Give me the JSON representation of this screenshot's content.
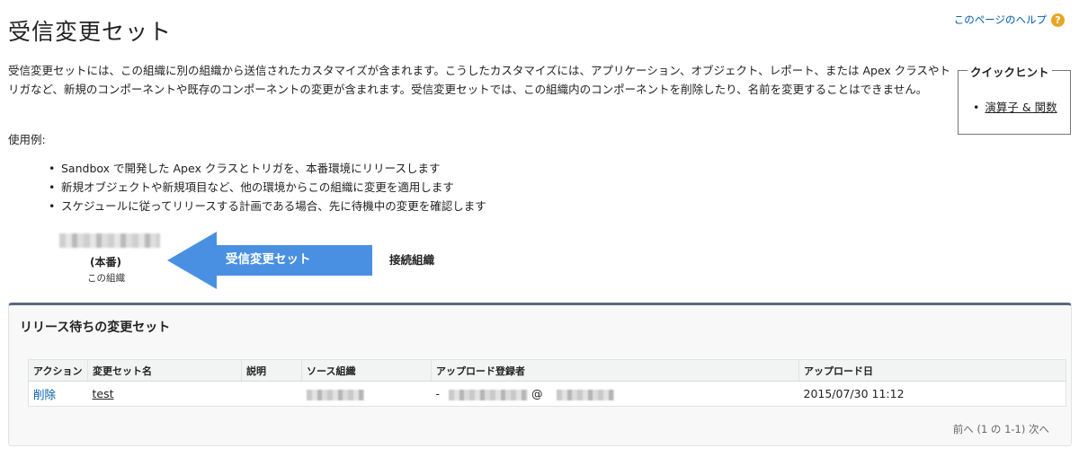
{
  "header": {
    "title": "受信変更セット",
    "help_label": "このページのヘルプ",
    "help_icon": "question-icon"
  },
  "intro": {
    "text": "受信変更セットには、この組織に別の組織から送信されたカスタマイズが含まれます。こうしたカスタマイズには、アプリケーション、オブジェクト、レポート、または Apex クラスやトリガなど、新規のコンポーネントや既存のコンポーネントの変更が含まれます。受信変更セットでは、この組織内のコンポーネントを削除したり、名前を変更することはできません。",
    "usage_label": "使用例:",
    "examples": [
      "Sandbox で開発した Apex クラスとトリガを、本番環境にリリースします",
      "新規オブジェクトや新規項目など、他の環境からこの組織に変更を適用します",
      "スケジュールに従ってリリースする計画である場合、先に待機中の変更を確認します"
    ]
  },
  "quickhint": {
    "title": "クイックヒント",
    "items": [
      "演算子 & 関数"
    ]
  },
  "diagram": {
    "prod_label": "(本番)",
    "this_org_label": "この組織",
    "arrow_label": "受信変更セット",
    "connected_org_label": "接続組織",
    "arrow_color": "#4a90e2"
  },
  "panel": {
    "title": "リリース待ちの変更セット",
    "columns": [
      "アクション",
      "変更セット名",
      "説明",
      "ソース組織",
      "アップロード登録者",
      "アップロード日"
    ],
    "rows": [
      {
        "action": "削除",
        "name": "test",
        "description": "",
        "uploader_prefix": "-",
        "uploader_at": "@",
        "upload_date": "2015/07/30 11:12"
      }
    ],
    "pager": {
      "prev": "前へ",
      "range": "(1 の 1-1)",
      "next": "次へ"
    }
  },
  "colors": {
    "link": "#015ba7",
    "panel_accent": "#5a6a7f",
    "help_icon": "#e8a526"
  }
}
